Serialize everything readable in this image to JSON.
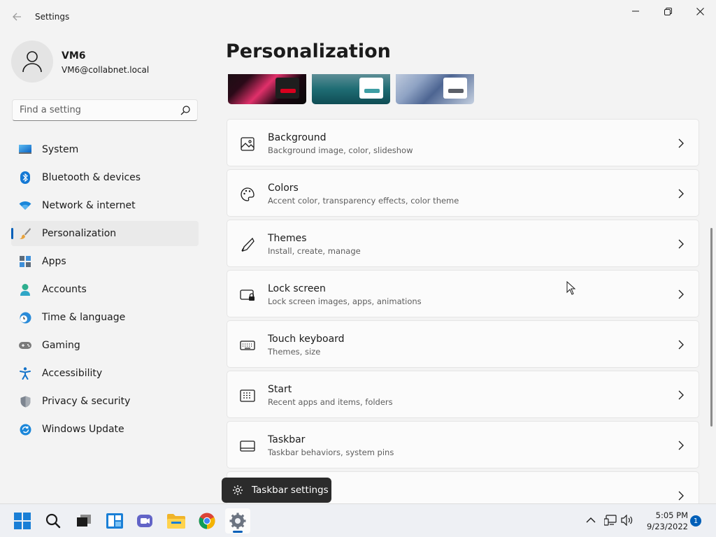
{
  "window": {
    "app_title": "Settings",
    "controls": [
      "minimize",
      "maximize",
      "close"
    ]
  },
  "profile": {
    "name": "VM6",
    "email": "VM6@collabnet.local"
  },
  "search": {
    "placeholder": "Find a setting"
  },
  "sidebar": {
    "active": "Personalization",
    "items": [
      {
        "label": "System",
        "icon": "system-icon"
      },
      {
        "label": "Bluetooth & devices",
        "icon": "bluetooth-icon"
      },
      {
        "label": "Network & internet",
        "icon": "wifi-icon"
      },
      {
        "label": "Personalization",
        "icon": "brush-icon"
      },
      {
        "label": "Apps",
        "icon": "apps-icon"
      },
      {
        "label": "Accounts",
        "icon": "person-icon"
      },
      {
        "label": "Time & language",
        "icon": "clock-globe-icon"
      },
      {
        "label": "Gaming",
        "icon": "gamepad-icon"
      },
      {
        "label": "Accessibility",
        "icon": "accessibility-icon"
      },
      {
        "label": "Privacy & security",
        "icon": "shield-icon"
      },
      {
        "label": "Windows Update",
        "icon": "update-icon"
      }
    ]
  },
  "main": {
    "page_title": "Personalization",
    "theme_thumbnails": [
      {
        "name": "glow-theme",
        "accent": "#d8001e"
      },
      {
        "name": "captured-motion-theme",
        "accent": "#3e9ea4"
      },
      {
        "name": "bloom-theme",
        "accent": "#5b5f68"
      }
    ],
    "cards": [
      {
        "title": "Background",
        "subtitle": "Background image, color, slideshow",
        "icon": "image-icon"
      },
      {
        "title": "Colors",
        "subtitle": "Accent color, transparency effects, color theme",
        "icon": "palette-icon"
      },
      {
        "title": "Themes",
        "subtitle": "Install, create, manage",
        "icon": "pen-icon"
      },
      {
        "title": "Lock screen",
        "subtitle": "Lock screen images, apps, animations",
        "icon": "lock-screen-icon"
      },
      {
        "title": "Touch keyboard",
        "subtitle": "Themes, size",
        "icon": "keyboard-icon"
      },
      {
        "title": "Start",
        "subtitle": "Recent apps and items, folders",
        "icon": "start-icon"
      },
      {
        "title": "Taskbar",
        "subtitle": "Taskbar behaviors, system pins",
        "icon": "taskbar-icon"
      },
      {
        "title": "",
        "subtitle": "",
        "icon": ""
      }
    ]
  },
  "tooltip": {
    "text": "Taskbar settings"
  },
  "taskbar": {
    "apps": [
      "start",
      "search",
      "task-view",
      "widgets",
      "teams-chat",
      "file-explorer",
      "chrome",
      "settings"
    ],
    "active_app": "settings",
    "clock": {
      "time": "5:05 PM",
      "date": "9/23/2022"
    },
    "notification_count": "1"
  },
  "colors": {
    "accent": "#005fb8",
    "background": "#f3f3f3",
    "card": "#fbfbfb"
  }
}
